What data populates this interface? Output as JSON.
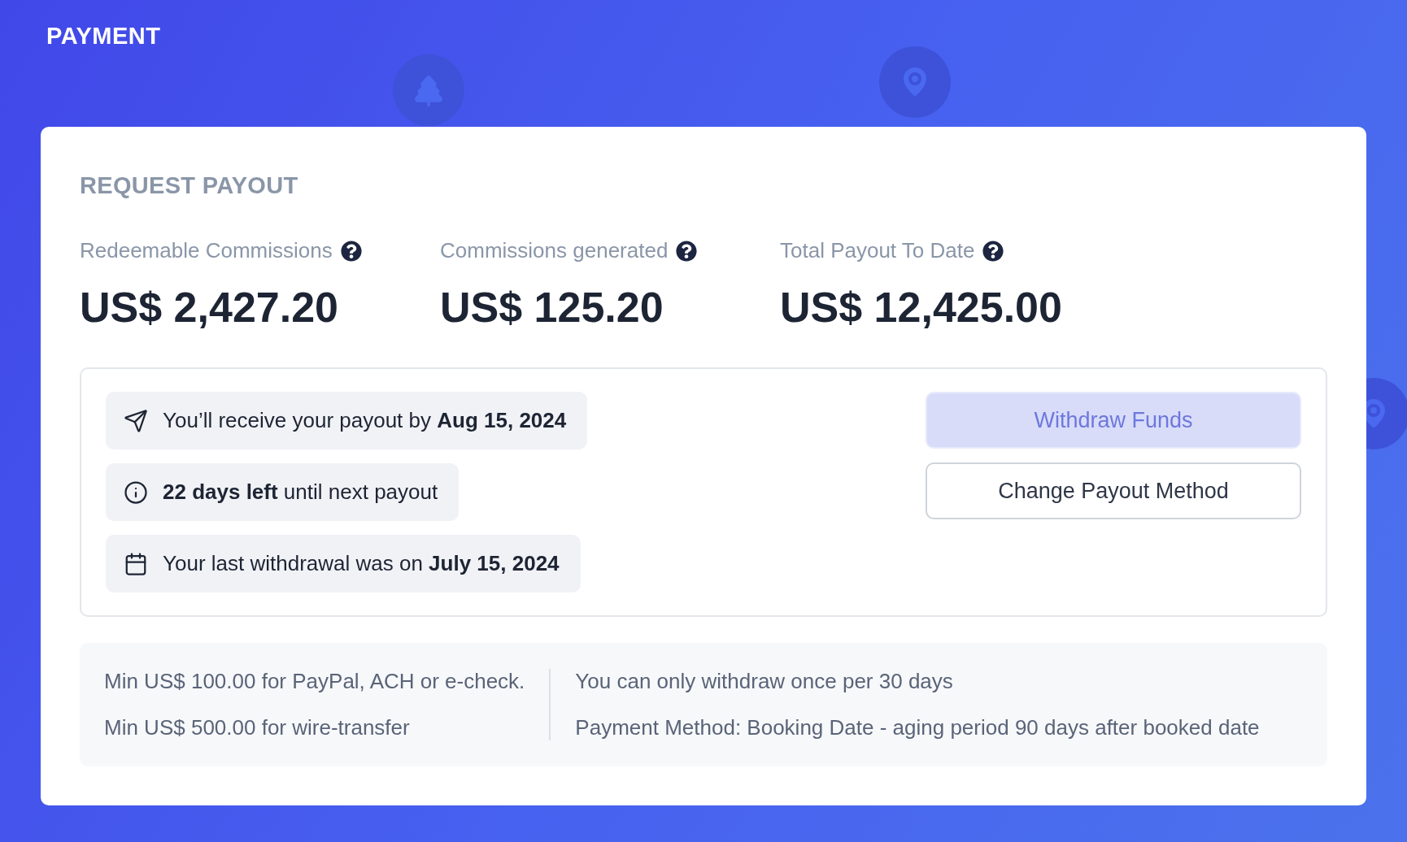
{
  "page_title": "PAYMENT",
  "card": {
    "title": "REQUEST PAYOUT",
    "stats": [
      {
        "label": "Redeemable Commissions",
        "value": "US$ 2,427.20"
      },
      {
        "label": "Commissions generated",
        "value": "US$ 125.20"
      },
      {
        "label": "Total Payout To Date",
        "value": "US$ 12,425.00"
      }
    ],
    "notices": [
      {
        "kind": "send",
        "text": "You’ll receive your payout by **Aug 15, 2024**"
      },
      {
        "kind": "info",
        "text": "**22 days left** until next payout"
      },
      {
        "kind": "calendar",
        "text": "Your last withdrawal was on **July 15, 2024**"
      }
    ],
    "buttons": [
      {
        "kind": "primary",
        "label": "Withdraw Funds",
        "disabled": true
      },
      {
        "kind": "outline",
        "label": "Change Payout Method",
        "disabled": false
      }
    ],
    "footer": {
      "left": [
        "Min US$ 100.00 for PayPal, ACH or e-check.",
        "Min US$ 500.00 for wire-transfer"
      ],
      "right": [
        "You can only withdraw once per 30 days",
        "Payment Method: Booking Date - aging period 90 days after booked date"
      ]
    }
  }
}
